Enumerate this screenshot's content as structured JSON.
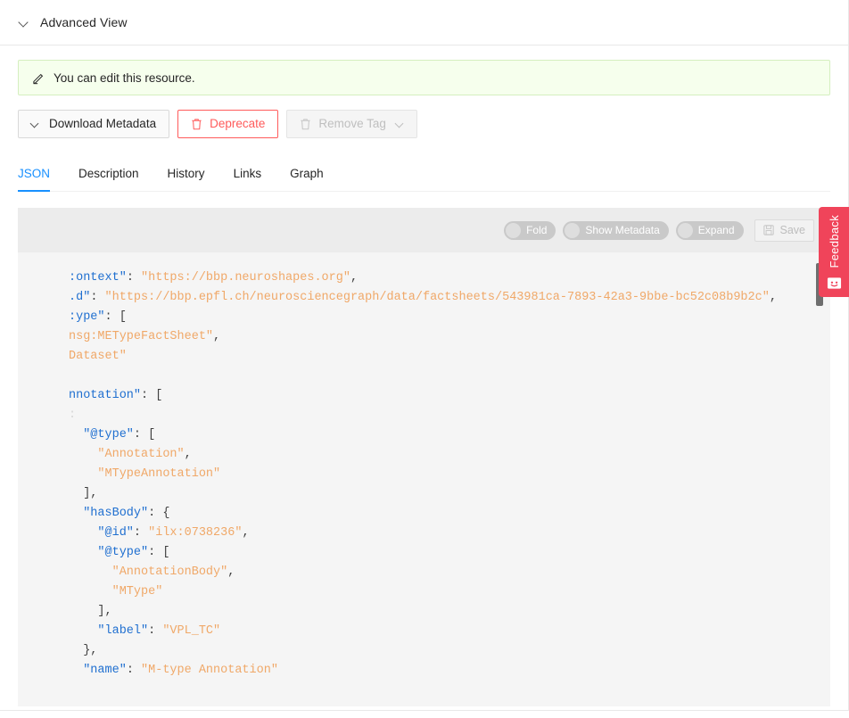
{
  "panel": {
    "title": "Advanced View",
    "collapse_icon": "chevron-down-icon"
  },
  "alert": {
    "icon": "edit-pencil-icon",
    "message": "You can edit this resource."
  },
  "actions": {
    "download_metadata": {
      "label": "Download Metadata",
      "icon": "chevron-down-icon",
      "disabled": false
    },
    "deprecate": {
      "label": "Deprecate",
      "icon": "trash-icon",
      "color": "#ff5b5b",
      "disabled": false
    },
    "remove_tag": {
      "label": "Remove Tag",
      "icon": "trash-icon",
      "dropdown_icon": "chevron-down-icon",
      "disabled": true
    }
  },
  "tabs": [
    {
      "label": "JSON",
      "active": true
    },
    {
      "label": "Description",
      "active": false
    },
    {
      "label": "History",
      "active": false
    },
    {
      "label": "Links",
      "active": false
    },
    {
      "label": "Graph",
      "active": false
    }
  ],
  "json_toolbar": {
    "toggles": [
      {
        "label": "Fold",
        "on": false
      },
      {
        "label": "Show Metadata",
        "on": false
      },
      {
        "label": "Expand",
        "on": false
      }
    ],
    "save": {
      "label": "Save",
      "icon": "save-floppy-icon",
      "disabled": true
    }
  },
  "json_viewer": {
    "horizontally_scrolled": true,
    "lines": [
      [
        {
          "t": ":ontext\"",
          "c": "k"
        },
        {
          "t": ": ",
          "c": "p"
        },
        {
          "t": "\"https://bbp.neuroshapes.org\"",
          "c": "s"
        },
        {
          "t": ",",
          "c": "p"
        }
      ],
      [
        {
          "t": ".d\"",
          "c": "k"
        },
        {
          "t": ": ",
          "c": "p"
        },
        {
          "t": "\"https://bbp.epfl.ch/neurosciencegraph/data/factsheets/543981ca-7893-42a3-9bbe-bc52c08b9b2c\"",
          "c": "s"
        },
        {
          "t": ",",
          "c": "p"
        }
      ],
      [
        {
          "t": ":ype\"",
          "c": "k"
        },
        {
          "t": ": [",
          "c": "p"
        }
      ],
      [
        {
          "t": "nsg:METypeFactSheet\"",
          "c": "s"
        },
        {
          "t": ",",
          "c": "p"
        }
      ],
      [
        {
          "t": "Dataset\"",
          "c": "s"
        }
      ],
      [],
      [
        {
          "t": "nnotation\"",
          "c": "k"
        },
        {
          "t": ": [",
          "c": "p"
        }
      ],
      [
        {
          "t": ":",
          "c": "faint"
        }
      ],
      [
        {
          "t": "  ",
          "c": "p"
        },
        {
          "t": "\"@type\"",
          "c": "k"
        },
        {
          "t": ": [",
          "c": "p"
        }
      ],
      [
        {
          "t": "    ",
          "c": "p"
        },
        {
          "t": "\"Annotation\"",
          "c": "s"
        },
        {
          "t": ",",
          "c": "p"
        }
      ],
      [
        {
          "t": "    ",
          "c": "p"
        },
        {
          "t": "\"MTypeAnnotation\"",
          "c": "s"
        }
      ],
      [
        {
          "t": "  ],",
          "c": "p"
        }
      ],
      [
        {
          "t": "  ",
          "c": "p"
        },
        {
          "t": "\"hasBody\"",
          "c": "k"
        },
        {
          "t": ": {",
          "c": "p"
        }
      ],
      [
        {
          "t": "    ",
          "c": "p"
        },
        {
          "t": "\"@id\"",
          "c": "k"
        },
        {
          "t": ": ",
          "c": "p"
        },
        {
          "t": "\"ilx:0738236\"",
          "c": "s"
        },
        {
          "t": ",",
          "c": "p"
        }
      ],
      [
        {
          "t": "    ",
          "c": "p"
        },
        {
          "t": "\"@type\"",
          "c": "k"
        },
        {
          "t": ": [",
          "c": "p"
        }
      ],
      [
        {
          "t": "      ",
          "c": "p"
        },
        {
          "t": "\"AnnotationBody\"",
          "c": "s"
        },
        {
          "t": ",",
          "c": "p"
        }
      ],
      [
        {
          "t": "      ",
          "c": "p"
        },
        {
          "t": "\"MType\"",
          "c": "s"
        }
      ],
      [
        {
          "t": "    ],",
          "c": "p"
        }
      ],
      [
        {
          "t": "    ",
          "c": "p"
        },
        {
          "t": "\"label\"",
          "c": "k"
        },
        {
          "t": ": ",
          "c": "p"
        },
        {
          "t": "\"VPL_TC\"",
          "c": "s"
        }
      ],
      [
        {
          "t": "  },",
          "c": "p"
        }
      ],
      [
        {
          "t": "  ",
          "c": "p"
        },
        {
          "t": "\"name\"",
          "c": "k"
        },
        {
          "t": ": ",
          "c": "p"
        },
        {
          "t": "\"M-type Annotation\"",
          "c": "s"
        }
      ]
    ]
  },
  "feedback": {
    "label": "Feedback",
    "icon": "smiley-face-icon",
    "color": "#f0445a"
  }
}
